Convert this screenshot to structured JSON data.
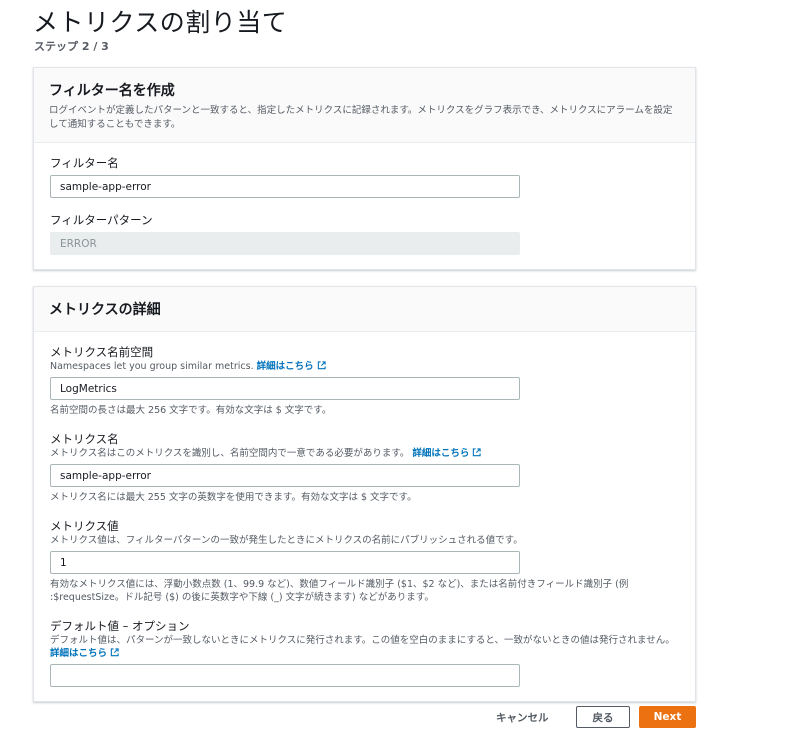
{
  "header": {
    "title": "メトリクスの割り当て",
    "step": "ステップ 2 / 3"
  },
  "filter_panel": {
    "title": "フィルター名を作成",
    "description": "ログイベントが定義したパターンと一致すると、指定したメトリクスに記録されます。メトリクスをグラフ表示でき、メトリクスにアラームを設定して通知することもできます。",
    "filter_name": {
      "label": "フィルター名",
      "value": "sample-app-error"
    },
    "filter_pattern": {
      "label": "フィルターパターン",
      "value": "ERROR"
    }
  },
  "metrics_panel": {
    "title": "メトリクスの詳細",
    "namespace": {
      "label": "メトリクス名前空間",
      "description": "Namespaces let you group similar metrics.",
      "link": "詳細はこちら",
      "value": "LogMetrics",
      "hint": "名前空間の長さは最大 256 文字です。有効な文字は $ 文字です。"
    },
    "metric_name": {
      "label": "メトリクス名",
      "description": "メトリクス名はこのメトリクスを識別し、名前空間内で一意である必要があります。",
      "link": "詳細はこちら",
      "value": "sample-app-error",
      "hint": "メトリクス名には最大 255 文字の英数字を使用できます。有効な文字は $ 文字です。"
    },
    "metric_value": {
      "label": "メトリクス値",
      "description": "メトリクス値は、フィルターパターンの一致が発生したときにメトリクスの名前にパブリッシュされる値です。",
      "value": "1",
      "hint": "有効なメトリクス値には、浮動小数点数 (1、99.9 など)、数値フィールド識別子 ($1、$2 など)、または名前付きフィールド識別子 (例 :$requestSize。ドル記号 ($) の後に英数字や下線 (_) 文字が続きます) などがあります。"
    },
    "default_value": {
      "label": "デフォルト値 – オプション",
      "description": "デフォルト値は、パターンが一致しないときにメトリクスに発行されます。この値を空白のままにすると、一致がないときの値は発行されません。",
      "link": "詳細はこちら",
      "value": ""
    }
  },
  "footer": {
    "cancel_label": "キャンセル",
    "back_label": "戻る",
    "next_label": "Next"
  },
  "colors": {
    "accent": "#ec7211",
    "link": "#0073bb"
  }
}
